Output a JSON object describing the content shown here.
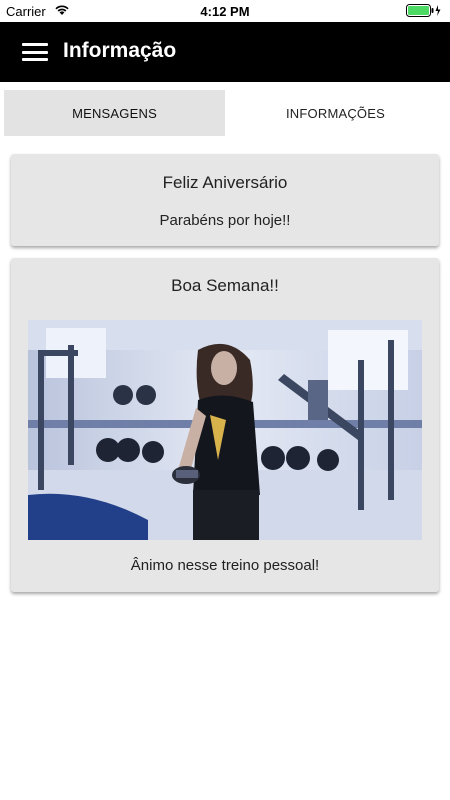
{
  "status_bar": {
    "carrier": "Carrier",
    "time": "4:12 PM",
    "battery_color": "#4cd964"
  },
  "app_bar": {
    "title": "Informação",
    "menu_icon": "hamburger-menu-icon"
  },
  "tabs": [
    {
      "label": "MENSAGENS",
      "selected": true
    },
    {
      "label": "INFORMAÇÕES",
      "selected": false
    }
  ],
  "messages": [
    {
      "title": "Feliz Aniversário",
      "text": "Parabéns por hoje!!"
    },
    {
      "title": "Boa Semana!!",
      "image": "photo-woman-lifting-dumbbell-in-gym",
      "text": "Ânimo nesse treino pessoal!"
    }
  ],
  "colors": {
    "app_bar": "#000000",
    "card_background": "#e6e6e6",
    "active_tab": "#e3e3e3"
  }
}
